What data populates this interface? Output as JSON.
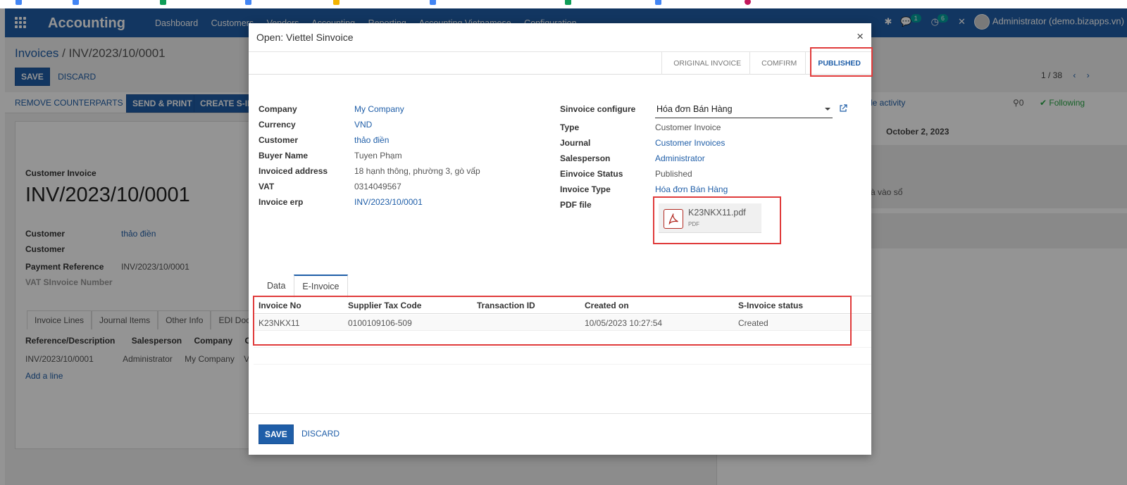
{
  "navbar": {
    "app_name": "Accounting",
    "menu": [
      "Dashboard",
      "Customers",
      "Vendors",
      "Accounting",
      "Reporting",
      "Accounting Vietnamese",
      "Configuration"
    ],
    "chat_badge": "1",
    "activity_badge": "6",
    "user": "Administrator (demo.bizapps.vn)"
  },
  "background": {
    "breadcrumb_root": "Invoices",
    "breadcrumb_sep": " / ",
    "breadcrumb_current": "INV/2023/10/0001",
    "save": "SAVE",
    "discard": "DISCARD",
    "pager": "1 / 38",
    "actions": [
      "REMOVE COUNTERPARTS",
      "SEND & PRINT",
      "CREATE S-INV"
    ],
    "chatter_activity": "le activity",
    "followers_count": "0",
    "following": "Following",
    "chatter_date": "October 2, 2023",
    "chatter_msg": "à vào sổ",
    "doc_type": "Customer Invoice",
    "doc_number": "INV/2023/10/0001",
    "fields": [
      {
        "label": "Customer",
        "value": "thảo điền"
      },
      {
        "label": "Customer",
        "value": ""
      },
      {
        "label": "Payment Reference",
        "value": "INV/2023/10/0001"
      },
      {
        "label": "VAT SInvoice Number",
        "value": ""
      }
    ],
    "tabs": [
      "Invoice Lines",
      "Journal Items",
      "Other Info",
      "EDI Docu"
    ],
    "cols": [
      "Reference/Description",
      "Salesperson",
      "Company",
      "Cu"
    ],
    "row": [
      "INV/2023/10/0001",
      "Administrator",
      "My Company",
      "VN"
    ],
    "add_line": "Add a line"
  },
  "modal": {
    "title": "Open: Viettel Sinvoice",
    "close": "×",
    "stages": [
      "ORIGINAL INVOICE",
      "COMFIRM",
      "PUBLISHED"
    ],
    "active_stage": "PUBLISHED",
    "left_fields": [
      {
        "label": "Company",
        "value": "My Company",
        "link": true
      },
      {
        "label": "Currency",
        "value": "VND",
        "link": true
      },
      {
        "label": "Customer",
        "value": "thảo điền",
        "link": true
      },
      {
        "label": "Buyer Name",
        "value": "Tuyen Phạm",
        "link": false
      },
      {
        "label": "Invoiced address",
        "value": "18 hạnh thông, phường 3, gò vấp",
        "link": false
      },
      {
        "label": "VAT",
        "value": "0314049567",
        "link": false
      },
      {
        "label": "Invoice erp",
        "value": "INV/2023/10/0001",
        "link": true
      }
    ],
    "right_fields": [
      {
        "label": "Sinvoice configure",
        "value": "Hóa đơn Bán Hàng",
        "link": false
      },
      {
        "label": "Type",
        "value": "Customer Invoice",
        "link": false
      },
      {
        "label": "Journal",
        "value": "Customer Invoices",
        "link": true
      },
      {
        "label": "Salesperson",
        "value": "Administrator",
        "link": true
      },
      {
        "label": "Einvoice Status",
        "value": "Published",
        "link": false
      },
      {
        "label": "Invoice Type",
        "value": "Hóa đơn Bán Hàng",
        "link": true
      },
      {
        "label": "PDF file",
        "value": "",
        "link": false
      }
    ],
    "attachment": {
      "name": "K23NKX11.pdf",
      "type": "PDF"
    },
    "tabs": [
      "Data",
      "E-Invoice"
    ],
    "active_tab": "E-Invoice",
    "table": {
      "columns": [
        "Invoice No",
        "Supplier Tax Code",
        "Transaction ID",
        "Created on",
        "S-Invoice status"
      ],
      "rows": [
        [
          "K23NKX11",
          "0100109106-509",
          "",
          "10/05/2023 10:27:54",
          "Created"
        ]
      ]
    },
    "save": "SAVE",
    "discard": "DISCARD"
  },
  "colors": {
    "primary": "#1f5ea8",
    "highlight": "#e03b3b"
  }
}
